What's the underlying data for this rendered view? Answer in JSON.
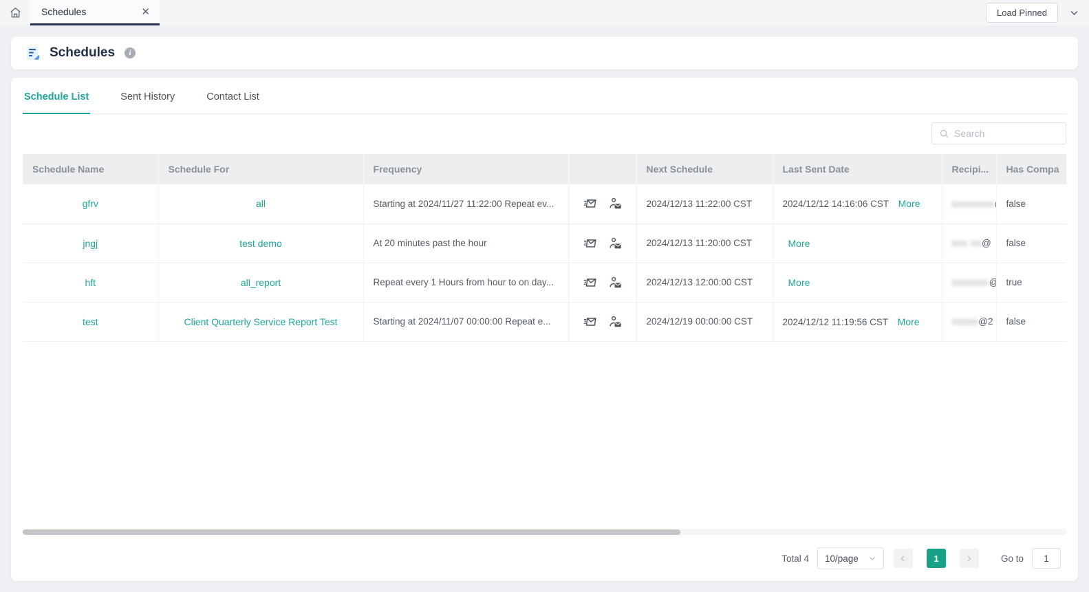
{
  "colors": {
    "accent": "#1FA79B",
    "pager_active": "#17A287",
    "title_navy": "#22304A",
    "tab_underline": "#252E49"
  },
  "topbar": {
    "tab_title": "Schedules",
    "load_pinned_label": "Load Pinned"
  },
  "page_header": {
    "title": "Schedules"
  },
  "tabs": [
    {
      "label": "Schedule List",
      "active": true
    },
    {
      "label": "Sent History",
      "active": false
    },
    {
      "label": "Contact List",
      "active": false
    }
  ],
  "search": {
    "placeholder": "Search"
  },
  "table": {
    "columns": {
      "schedule_name": "Schedule Name",
      "schedule_for": "Schedule For",
      "frequency": "Frequency",
      "actions": "",
      "next_schedule": "Next Schedule",
      "last_sent_date": "Last Sent Date",
      "recipients": "Recipi...",
      "has_company": "Has Compa"
    },
    "rows": [
      {
        "schedule_name": "gfrv",
        "schedule_for": "all",
        "frequency": "Starting at 2024/11/27 11:22:00 Repeat ev...",
        "next_schedule": "2024/12/13 11:22:00 CST",
        "last_sent_date": "2024/12/12 14:16:06 CST",
        "more_label": "More",
        "recipient_masked": "xxxxxxxx",
        "recipient_suffix": "@",
        "has_company": "false"
      },
      {
        "schedule_name": "jngj",
        "schedule_for": "test demo",
        "frequency": "At 20 minutes past the hour",
        "next_schedule": "2024/12/13 11:20:00 CST",
        "last_sent_date": "",
        "more_label": "More",
        "recipient_masked": "xxx xx",
        "recipient_suffix": "@",
        "has_company": "false"
      },
      {
        "schedule_name": "hft",
        "schedule_for": "all_report",
        "frequency": "Repeat every 1 Hours from hour to on day...",
        "next_schedule": "2024/12/13 12:00:00 CST",
        "last_sent_date": "",
        "more_label": "More",
        "recipient_masked": "xxxxxxx",
        "recipient_suffix": "@",
        "has_company": "true"
      },
      {
        "schedule_name": "test",
        "schedule_for": "Client Quarterly Service Report Test",
        "frequency": "Starting at 2024/11/07 00:00:00 Repeat e...",
        "next_schedule": "2024/12/19 00:00:00 CST",
        "last_sent_date": "2024/12/12 11:19:56 CST",
        "more_label": "More",
        "recipient_masked": "xxxxx",
        "recipient_suffix": "@2",
        "has_company": "false"
      }
    ]
  },
  "pagination": {
    "total_label": "Total 4",
    "page_size": "10/page",
    "current_page": "1",
    "goto_label": "Go to",
    "goto_value": "1"
  }
}
